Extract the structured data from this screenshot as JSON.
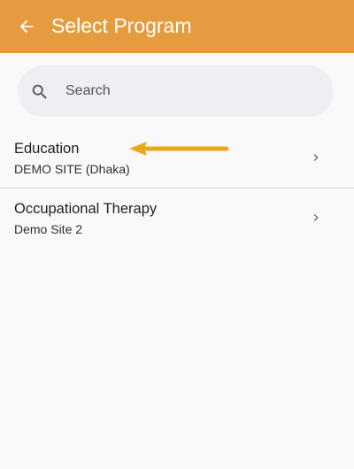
{
  "header": {
    "title": "Select Program",
    "back_icon": "arrow-left-icon",
    "background_color": "#e59c3f"
  },
  "search": {
    "placeholder": "Search",
    "value": "",
    "icon": "search-icon"
  },
  "programs": [
    {
      "title": "Education",
      "site": "DEMO SITE (Dhaka)"
    },
    {
      "title": "Occupational Therapy",
      "site": "Demo Site 2"
    }
  ],
  "annotation": {
    "icon": "arrow-left-icon",
    "color": "#eaa91b"
  }
}
